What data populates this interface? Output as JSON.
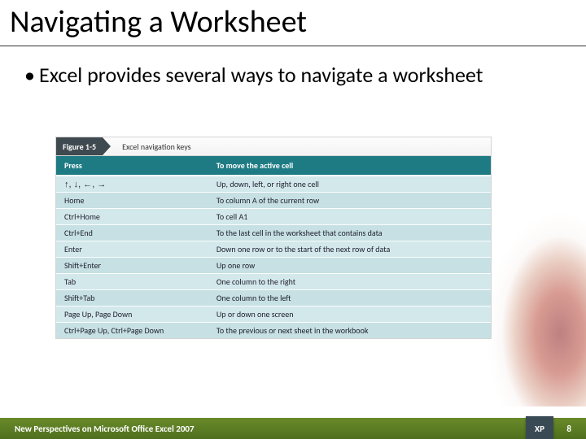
{
  "title": "Navigating a Worksheet",
  "bullet": "Excel provides several ways to navigate a worksheet",
  "figure": {
    "number": "Figure 1-5",
    "caption": "Excel navigation keys",
    "headers": [
      "Press",
      "To move the active cell"
    ],
    "rows": [
      {
        "key": "↑, ↓, ←, →",
        "desc": "Up, down, left, or right one cell"
      },
      {
        "key": "Home",
        "desc": "To column A of the current row"
      },
      {
        "key": "Ctrl+Home",
        "desc": "To cell A1"
      },
      {
        "key": "Ctrl+End",
        "desc": "To the last cell in the worksheet that contains data"
      },
      {
        "key": "Enter",
        "desc": "Down one row or to the start of the next row of data"
      },
      {
        "key": "Shift+Enter",
        "desc": "Up one row"
      },
      {
        "key": "Tab",
        "desc": "One column to the right"
      },
      {
        "key": "Shift+Tab",
        "desc": "One column to the left"
      },
      {
        "key": "Page Up, Page Down",
        "desc": "Up or down one screen"
      },
      {
        "key": "Ctrl+Page Up, Ctrl+Page Down",
        "desc": "To the previous or next sheet in the workbook"
      }
    ]
  },
  "footer": {
    "book": "New Perspectives on Microsoft Office Excel 2007",
    "page": "8",
    "badge": "XP"
  }
}
